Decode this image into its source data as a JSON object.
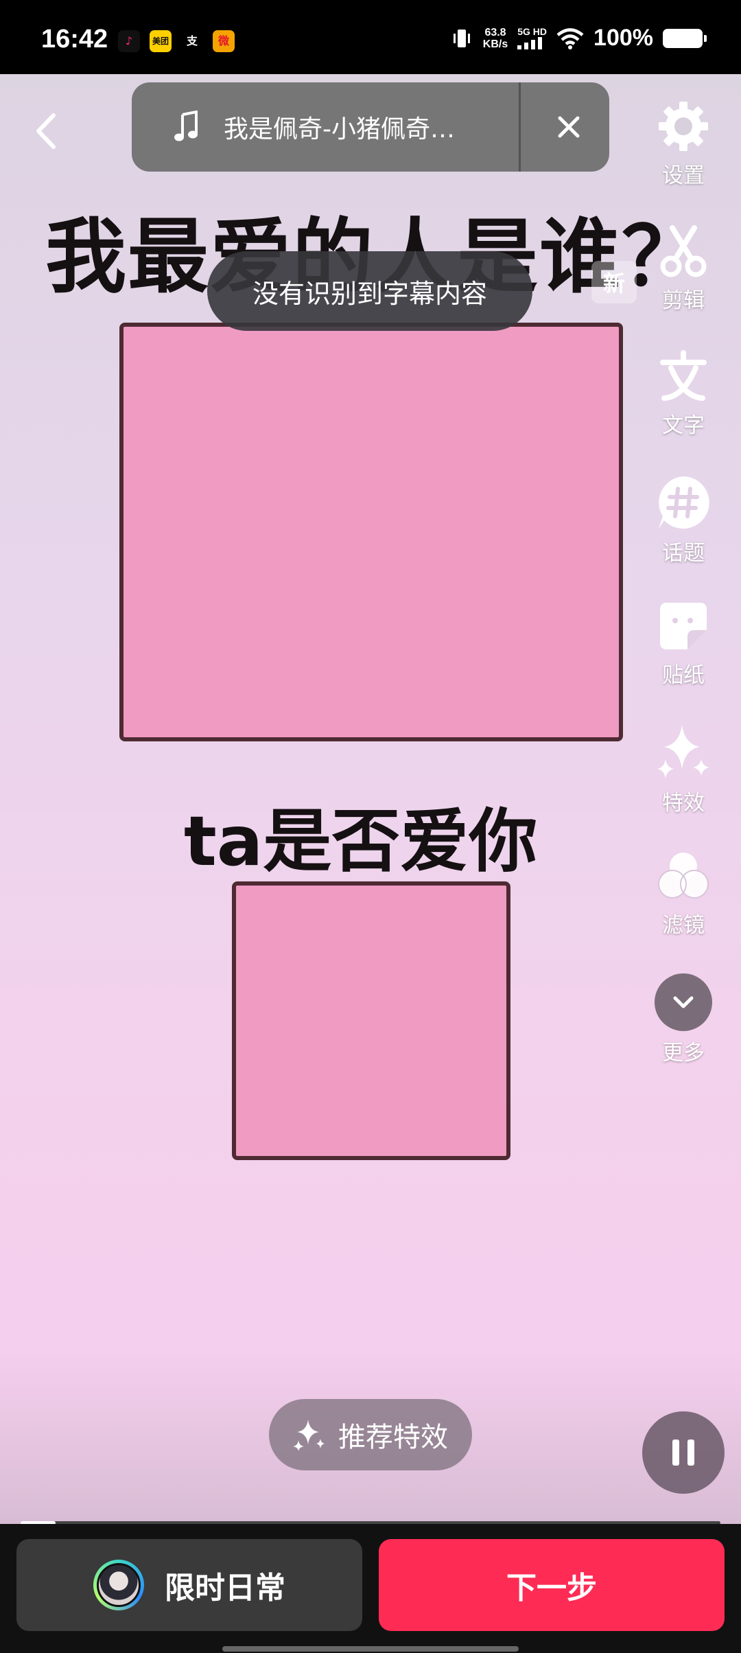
{
  "status_bar": {
    "time": "16:42",
    "app_icons": [
      {
        "name": "douyin-icon",
        "text": "♪",
        "bg": "#111111",
        "fg": "#ff2b6a"
      },
      {
        "name": "meituan-icon",
        "text": "美团",
        "bg": "#ffd000",
        "fg": "#111111"
      },
      {
        "name": "alipay-icon",
        "text": "支",
        "bg": "#000000",
        "fg": "#ffffff"
      },
      {
        "name": "weibo-icon",
        "text": "微",
        "bg": "#f5a300",
        "fg": "#e6162d"
      }
    ],
    "net_speed_value": "63.8",
    "net_speed_unit": "KB/s",
    "network_type": "5G HD",
    "battery_percent": "100%"
  },
  "music": {
    "title": "我是佩奇-小猪佩奇…"
  },
  "canvas": {
    "headline": "我最爱的人是谁？",
    "subheadline": "ta是否爱你",
    "toast": "没有识别到字幕内容",
    "new_badge": "新"
  },
  "tools": [
    {
      "label": "设置",
      "icon": "gear-icon"
    },
    {
      "label": "剪辑",
      "icon": "scissors-icon"
    },
    {
      "label": "文字",
      "icon": "text-icon"
    },
    {
      "label": "话题",
      "icon": "hashtag-icon"
    },
    {
      "label": "贴纸",
      "icon": "sticker-icon"
    },
    {
      "label": "特效",
      "icon": "sparkle-icon"
    },
    {
      "label": "滤镜",
      "icon": "filter-icon"
    },
    {
      "label": "更多",
      "icon": "chevron-down-icon"
    }
  ],
  "effects_button": {
    "label": "推荐特效"
  },
  "playback": {
    "progress": 0.05
  },
  "bottom_bar": {
    "daily_label": "限时日常",
    "next_label": "下一步"
  },
  "colors": {
    "accent": "#fe2c55",
    "box_fill": "#ef9bc2",
    "box_border": "#4e2a32"
  }
}
